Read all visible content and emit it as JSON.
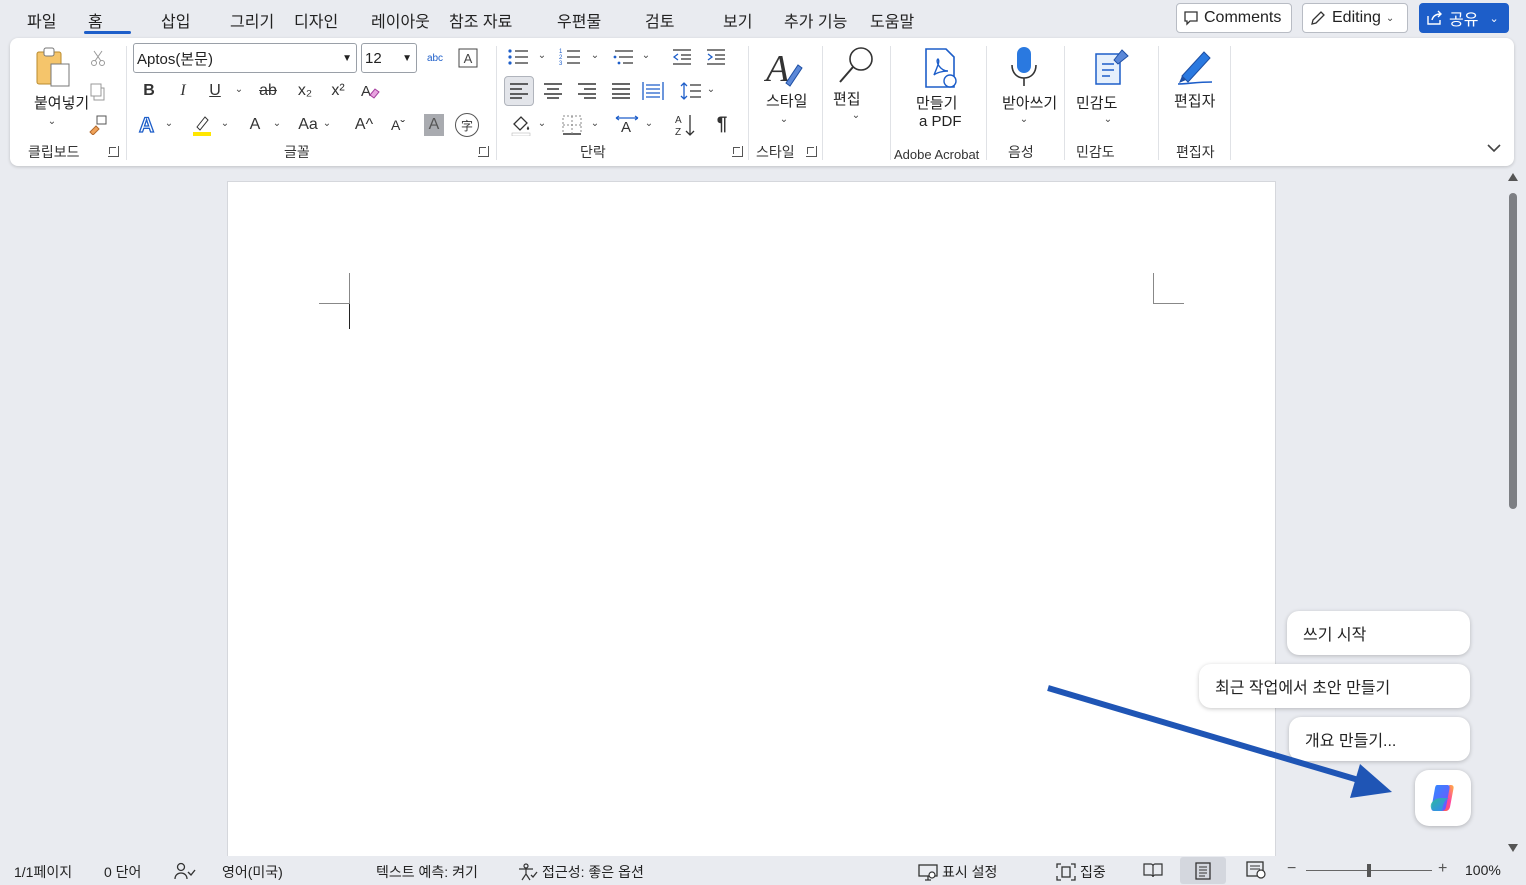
{
  "menu": {
    "tabs": [
      {
        "label": "파일"
      },
      {
        "label": "홈"
      },
      {
        "label": "삽입"
      },
      {
        "label": "그리기"
      },
      {
        "label": "디자인"
      },
      {
        "label": "레이아웃"
      },
      {
        "label": "참조 자료"
      },
      {
        "label": "우편물"
      },
      {
        "label": "검토"
      },
      {
        "label": "보기"
      },
      {
        "label": "추가 기능"
      },
      {
        "label": "도움말"
      }
    ],
    "active_tab": "홈",
    "comments_label": "Comments",
    "editing_label": "Editing",
    "share_label": "공유"
  },
  "ribbon": {
    "clipboard": {
      "paste_label": "붙여넣기",
      "group_label": "클립보드"
    },
    "font": {
      "font_name": "Aptos(본문)",
      "font_size": "12",
      "bold": "B",
      "italic": "I",
      "underline": "U",
      "strike": "ab",
      "subscript": "x₂",
      "superscript": "x²",
      "font_color_glyph": "A",
      "change_case": "Aa",
      "grow": "A^",
      "shrink": "Aˇ",
      "shade": "A",
      "enclose": "字",
      "group_label": "글꼴"
    },
    "paragraph": {
      "group_label": "단락",
      "pilcrow": "¶"
    },
    "styles": {
      "label": "스타일",
      "group_label": "스타일"
    },
    "editing": {
      "label": "편집"
    },
    "acrobat": {
      "label_line1": "만들기",
      "label_line2": "a PDF",
      "group_label": "Adobe Acrobat"
    },
    "voice": {
      "label": "받아쓰기",
      "group_label": "음성"
    },
    "sensitivity": {
      "label": "민감도",
      "group_label": "민감도"
    },
    "editor": {
      "label": "편집자",
      "group_label": "편집자"
    }
  },
  "copilot": {
    "suggestions": [
      {
        "label": "쓰기 시작"
      },
      {
        "label": "최근 작업에서 초안 만들기"
      },
      {
        "label": "개요 만들기..."
      }
    ]
  },
  "status": {
    "page": "1/1페이지",
    "words": "0 단어",
    "language": "영어(미국)",
    "text_prediction": "텍스트 예측: 켜기",
    "accessibility": "접근성: 좋은 옵션",
    "display_settings": "표시 설정",
    "focus": "집중",
    "zoom": "100%",
    "zoom_level": 1.0
  },
  "colors": {
    "accent": "#1d5ec9",
    "background": "#e9ebf0",
    "arrow": "#1f55b5"
  }
}
